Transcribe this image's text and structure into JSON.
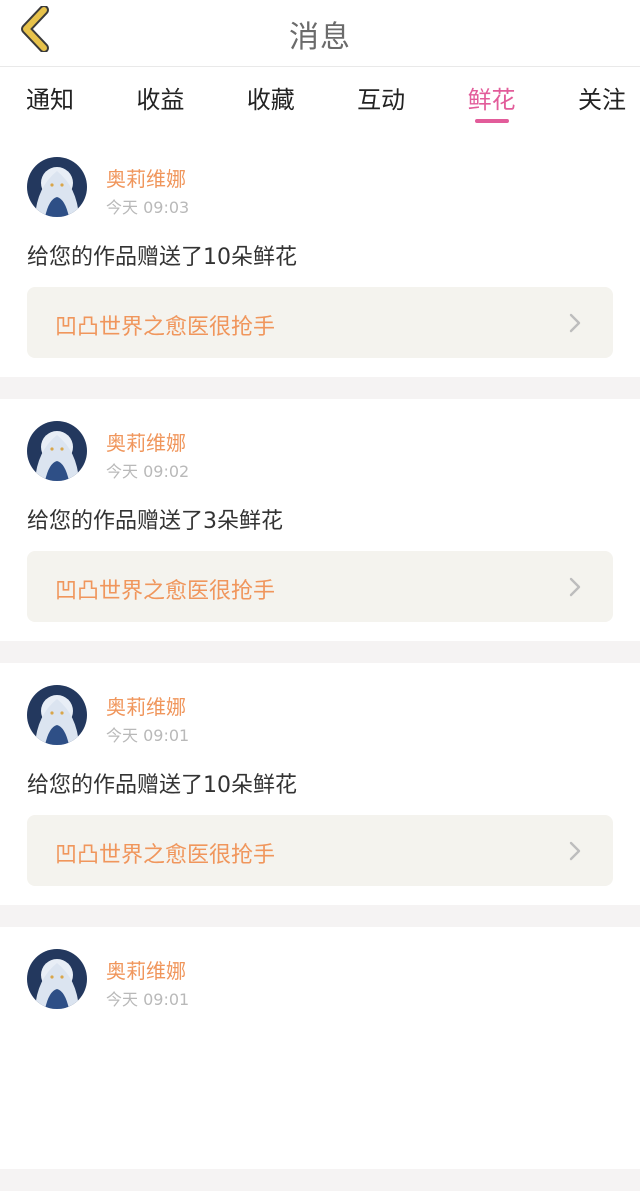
{
  "header": {
    "title": "消息"
  },
  "tabs": [
    {
      "label": "通知",
      "active": false
    },
    {
      "label": "收益",
      "active": false
    },
    {
      "label": "收藏",
      "active": false
    },
    {
      "label": "互动",
      "active": false
    },
    {
      "label": "鲜花",
      "active": true
    },
    {
      "label": "关注",
      "active": false
    }
  ],
  "messages": [
    {
      "username": "奥莉维娜",
      "time": "今天 09:03",
      "text": "给您的作品赠送了10朵鲜花",
      "work": "凹凸世界之愈医很抢手"
    },
    {
      "username": "奥莉维娜",
      "time": "今天 09:02",
      "text": "给您的作品赠送了3朵鲜花",
      "work": "凹凸世界之愈医很抢手"
    },
    {
      "username": "奥莉维娜",
      "time": "今天 09:01",
      "text": "给您的作品赠送了10朵鲜花",
      "work": "凹凸世界之愈医很抢手"
    },
    {
      "username": "奥莉维娜",
      "time": "今天 09:01",
      "text": "",
      "work": ""
    }
  ],
  "colors": {
    "accent": "#e25c9a",
    "username": "#f0965c",
    "back_arrow": "#e7c24b"
  }
}
